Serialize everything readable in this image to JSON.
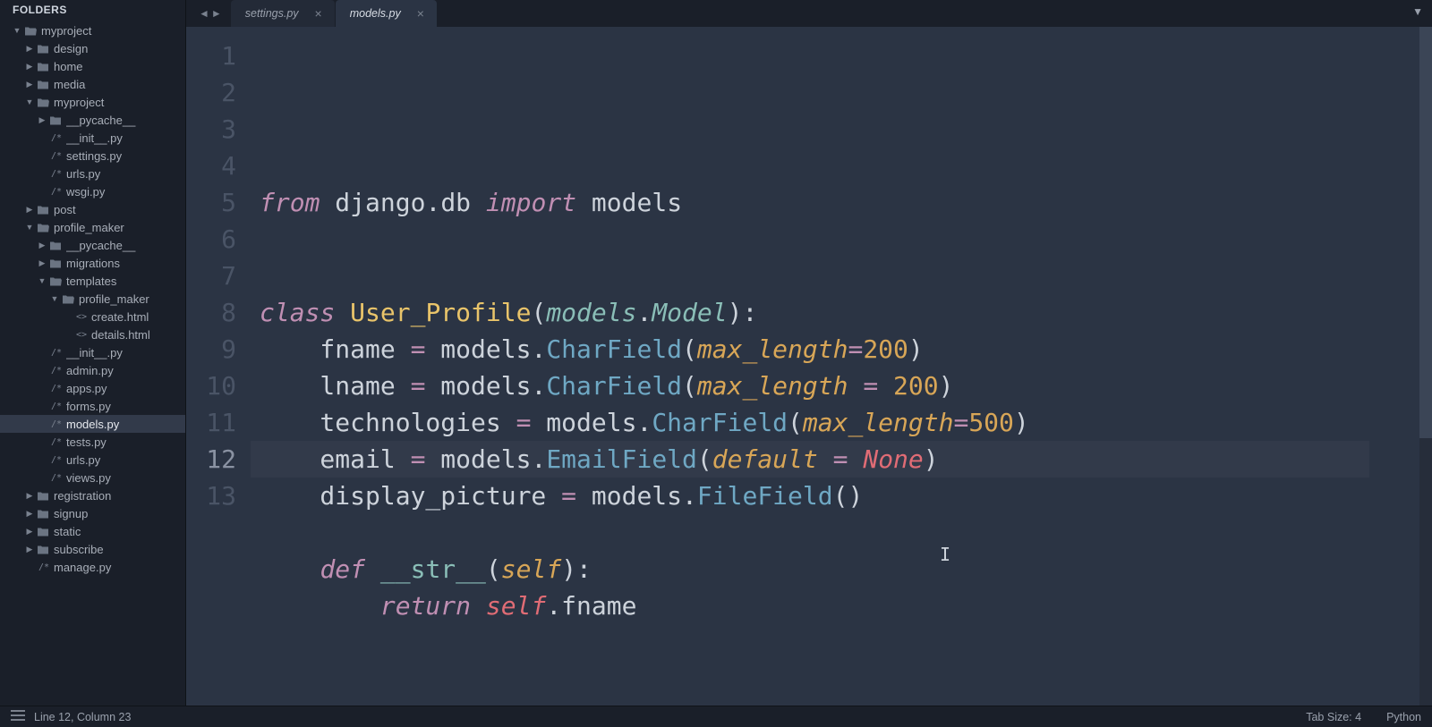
{
  "sidebar": {
    "header": "FOLDERS",
    "tree": [
      {
        "d": 0,
        "t": "folder",
        "open": true,
        "label": "myproject"
      },
      {
        "d": 1,
        "t": "folder",
        "open": false,
        "label": "design"
      },
      {
        "d": 1,
        "t": "folder",
        "open": false,
        "label": "home"
      },
      {
        "d": 1,
        "t": "folder",
        "open": false,
        "label": "media"
      },
      {
        "d": 1,
        "t": "folder",
        "open": true,
        "label": "myproject"
      },
      {
        "d": 2,
        "t": "folder",
        "open": false,
        "label": "__pycache__"
      },
      {
        "d": 2,
        "t": "py",
        "label": "__init__.py"
      },
      {
        "d": 2,
        "t": "py",
        "label": "settings.py"
      },
      {
        "d": 2,
        "t": "py",
        "label": "urls.py"
      },
      {
        "d": 2,
        "t": "py",
        "label": "wsgi.py"
      },
      {
        "d": 1,
        "t": "folder",
        "open": false,
        "label": "post"
      },
      {
        "d": 1,
        "t": "folder",
        "open": true,
        "label": "profile_maker"
      },
      {
        "d": 2,
        "t": "folder",
        "open": false,
        "label": "__pycache__"
      },
      {
        "d": 2,
        "t": "folder",
        "open": false,
        "label": "migrations"
      },
      {
        "d": 2,
        "t": "folder",
        "open": true,
        "label": "templates"
      },
      {
        "d": 3,
        "t": "folder",
        "open": true,
        "label": "profile_maker"
      },
      {
        "d": 4,
        "t": "html",
        "label": "create.html"
      },
      {
        "d": 4,
        "t": "html",
        "label": "details.html"
      },
      {
        "d": 2,
        "t": "py",
        "label": "__init__.py"
      },
      {
        "d": 2,
        "t": "py",
        "label": "admin.py"
      },
      {
        "d": 2,
        "t": "py",
        "label": "apps.py"
      },
      {
        "d": 2,
        "t": "py",
        "label": "forms.py"
      },
      {
        "d": 2,
        "t": "py",
        "label": "models.py",
        "active": true
      },
      {
        "d": 2,
        "t": "py",
        "label": "tests.py"
      },
      {
        "d": 2,
        "t": "py",
        "label": "urls.py"
      },
      {
        "d": 2,
        "t": "py",
        "label": "views.py"
      },
      {
        "d": 1,
        "t": "folder",
        "open": false,
        "label": "registration"
      },
      {
        "d": 1,
        "t": "folder",
        "open": false,
        "label": "signup"
      },
      {
        "d": 1,
        "t": "folder",
        "open": false,
        "label": "static"
      },
      {
        "d": 1,
        "t": "folder",
        "open": false,
        "label": "subscribe"
      },
      {
        "d": 1,
        "t": "py",
        "label": "manage.py"
      }
    ]
  },
  "tabs": [
    {
      "label": "settings.py",
      "active": false
    },
    {
      "label": "models.py",
      "active": true
    }
  ],
  "code": {
    "lines": [
      [
        [
          "kw",
          "from"
        ],
        [
          "var",
          " django"
        ],
        [
          "punc",
          "."
        ],
        [
          "var",
          "db "
        ],
        [
          "kw",
          "import"
        ],
        [
          "var",
          " models"
        ]
      ],
      [],
      [],
      [
        [
          "kw",
          "class"
        ],
        [
          "var",
          " "
        ],
        [
          "cls",
          "User_Profile"
        ],
        [
          "punc",
          "("
        ],
        [
          "type",
          "models"
        ],
        [
          "punc",
          "."
        ],
        [
          "type",
          "Model"
        ],
        [
          "punc",
          ")"
        ],
        [
          "punc",
          ":"
        ]
      ],
      [
        [
          "var",
          "    fname "
        ],
        [
          "op",
          "="
        ],
        [
          "var",
          " models"
        ],
        [
          "punc",
          "."
        ],
        [
          "fn",
          "CharField"
        ],
        [
          "punc",
          "("
        ],
        [
          "param",
          "max_length"
        ],
        [
          "op",
          "="
        ],
        [
          "num",
          "200"
        ],
        [
          "punc",
          ")"
        ]
      ],
      [
        [
          "var",
          "    lname "
        ],
        [
          "op",
          "="
        ],
        [
          "var",
          " models"
        ],
        [
          "punc",
          "."
        ],
        [
          "fn",
          "CharField"
        ],
        [
          "punc",
          "("
        ],
        [
          "param",
          "max_length"
        ],
        [
          "var",
          " "
        ],
        [
          "op",
          "="
        ],
        [
          "var",
          " "
        ],
        [
          "num",
          "200"
        ],
        [
          "punc",
          ")"
        ]
      ],
      [
        [
          "var",
          "    technologies "
        ],
        [
          "op",
          "="
        ],
        [
          "var",
          " models"
        ],
        [
          "punc",
          "."
        ],
        [
          "fn",
          "CharField"
        ],
        [
          "punc",
          "("
        ],
        [
          "param",
          "max_length"
        ],
        [
          "op",
          "="
        ],
        [
          "num",
          "500"
        ],
        [
          "punc",
          ")"
        ]
      ],
      [
        [
          "var",
          "    email "
        ],
        [
          "op",
          "="
        ],
        [
          "var",
          " models"
        ],
        [
          "punc",
          "."
        ],
        [
          "fn",
          "EmailField"
        ],
        [
          "punc",
          "("
        ],
        [
          "param",
          "default"
        ],
        [
          "var",
          " "
        ],
        [
          "op",
          "="
        ],
        [
          "var",
          " "
        ],
        [
          "const",
          "None"
        ],
        [
          "punc",
          ")"
        ]
      ],
      [
        [
          "var",
          "    display_picture "
        ],
        [
          "op",
          "="
        ],
        [
          "var",
          " models"
        ],
        [
          "punc",
          "."
        ],
        [
          "fn",
          "FileField"
        ],
        [
          "punc",
          "("
        ],
        [
          "punc",
          ")"
        ]
      ],
      [],
      [
        [
          "var",
          "    "
        ],
        [
          "def",
          "def"
        ],
        [
          "var",
          " "
        ],
        [
          "method",
          "__str__"
        ],
        [
          "punc",
          "("
        ],
        [
          "param",
          "self"
        ],
        [
          "punc",
          ")"
        ],
        [
          "punc",
          ":"
        ]
      ],
      [
        [
          "var",
          "        "
        ],
        [
          "kw",
          "return"
        ],
        [
          "var",
          " "
        ],
        [
          "self",
          "self"
        ],
        [
          "punc",
          "."
        ],
        [
          "var",
          "fname"
        ]
      ],
      []
    ],
    "active_line": 12
  },
  "status": {
    "position": "Line 12, Column 23",
    "tab_size": "Tab Size: 4",
    "language": "Python"
  }
}
